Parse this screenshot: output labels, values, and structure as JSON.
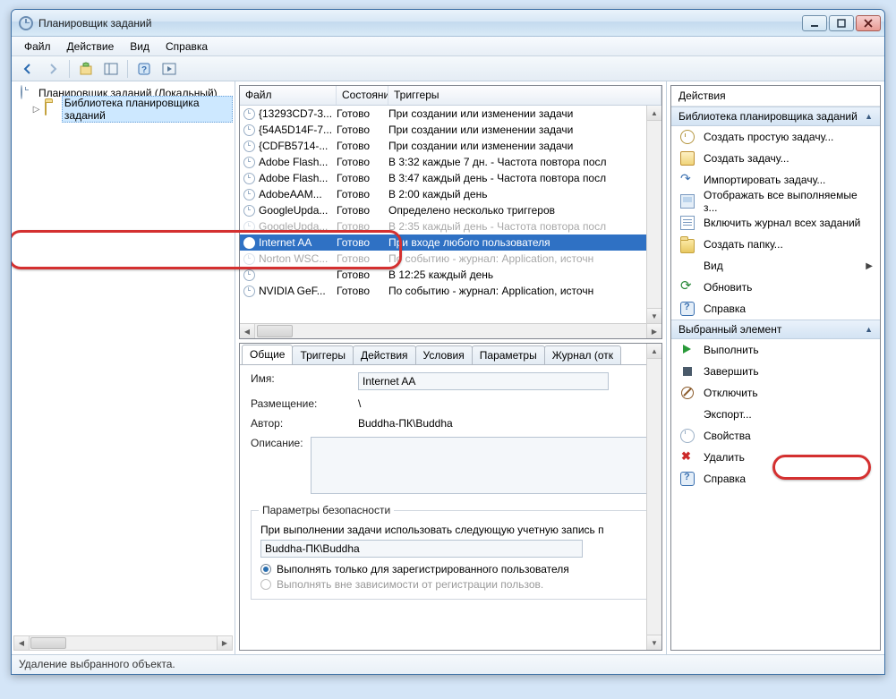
{
  "window": {
    "title": "Планировщик заданий"
  },
  "menu": {
    "file": "Файл",
    "action": "Действие",
    "view": "Вид",
    "help": "Справка"
  },
  "tree": {
    "root": "Планировщик заданий (Локальный)",
    "lib": "Библиотека планировщика заданий"
  },
  "list": {
    "headers": {
      "file": "Файл",
      "state": "Состояние",
      "triggers": "Триггеры"
    },
    "rows": [
      {
        "name": "{13293CD7-3...",
        "state": "Готово",
        "trigger": "При создании или изменении задачи"
      },
      {
        "name": "{54A5D14F-7...",
        "state": "Готово",
        "trigger": "При создании или изменении задачи"
      },
      {
        "name": "{CDFB5714-...",
        "state": "Готово",
        "trigger": "При создании или изменении задачи"
      },
      {
        "name": "Adobe Flash...",
        "state": "Готово",
        "trigger": "В 3:32 каждые 7 дн. - Частота повтора посл"
      },
      {
        "name": "Adobe Flash...",
        "state": "Готово",
        "trigger": "В 3:47 каждый день - Частота повтора посл"
      },
      {
        "name": "AdobeAAM...",
        "state": "Готово",
        "trigger": "В 2:00 каждый день"
      },
      {
        "name": "GoogleUpda...",
        "state": "Готово",
        "trigger": "Определено несколько триггеров"
      },
      {
        "name": "GoogleUpda...",
        "state": "Готово",
        "trigger": "В 2:35 каждый день - Частота повтора посл",
        "cut": true
      },
      {
        "name": "Internet AA",
        "state": "Готово",
        "trigger": "При входе любого пользователя",
        "selected": true
      },
      {
        "name": "Norton WSC...",
        "state": "Готово",
        "trigger": "По событию - журнал: Application, источн",
        "cut": true
      },
      {
        "name": "",
        "state": "Готово",
        "trigger": "В 12:25 каждый день"
      },
      {
        "name": "NVIDIA GeF...",
        "state": "Готово",
        "trigger": "По событию - журнал: Application, источн"
      }
    ]
  },
  "tabs": {
    "general": "Общие",
    "trig": "Триггеры",
    "act": "Действия",
    "cond": "Условия",
    "param": "Параметры",
    "log": "Журнал (отк"
  },
  "detail": {
    "nameLabel": "Имя:",
    "nameValue": "Internet AA",
    "locLabel": "Размещение:",
    "locValue": "\\",
    "authorLabel": "Автор:",
    "authorValue": "Buddha-ПК\\Buddha",
    "descLabel": "Описание:",
    "group": {
      "legend": "Параметры безопасности",
      "text": "При выполнении задачи использовать следующую учетную запись п",
      "account": "Buddha-ПК\\Buddha",
      "radio1": "Выполнять только для зарегистрированного пользователя",
      "radio2": "Выполнять вне зависимости от регистрации пользов."
    }
  },
  "actions": {
    "header": "Действия",
    "libSection": "Библиотека планировщика заданий",
    "libItems": {
      "createBasic": "Создать простую задачу...",
      "createTask": "Создать задачу...",
      "import": "Импортировать задачу...",
      "showAll": "Отображать все выполняемые з...",
      "enableLog": "Включить журнал всех заданий",
      "newFolder": "Создать папку...",
      "view": "Вид",
      "refresh": "Обновить",
      "help": "Справка"
    },
    "selSection": "Выбранный элемент",
    "selItems": {
      "run": "Выполнить",
      "end": "Завершить",
      "disable": "Отключить",
      "export": "Экспорт...",
      "props": "Свойства",
      "delete": "Удалить",
      "help": "Справка"
    }
  },
  "status": "Удаление выбранного объекта."
}
